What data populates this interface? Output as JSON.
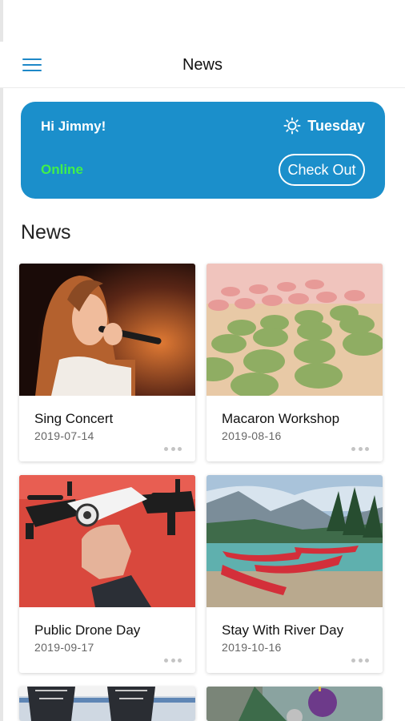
{
  "nav": {
    "title": "News",
    "menu_icon": "hamburger-menu-icon"
  },
  "banner": {
    "greeting": "Hi  Jimmy!",
    "day": "Tuesday",
    "weather_icon": "sun-icon",
    "status": "Online",
    "checkout_label": "Check Out",
    "colors": {
      "background": "#1b8fcb",
      "status": "#41f04a"
    }
  },
  "section": {
    "title": "News"
  },
  "news": [
    {
      "title": "Sing Concert",
      "date": "2019-07-14",
      "image": "singer-with-microphone"
    },
    {
      "title": "Macaron Workshop",
      "date": "2019-08-16",
      "image": "green-macarons"
    },
    {
      "title": "Public Drone Day",
      "date": "2019-09-17",
      "image": "hand-holding-drone"
    },
    {
      "title": "Stay With River Day",
      "date": "2019-10-16",
      "image": "canoes-on-lake"
    },
    {
      "title": "",
      "date": "",
      "image": "boots-partial"
    },
    {
      "title": "",
      "date": "",
      "image": "ornaments-partial"
    }
  ]
}
